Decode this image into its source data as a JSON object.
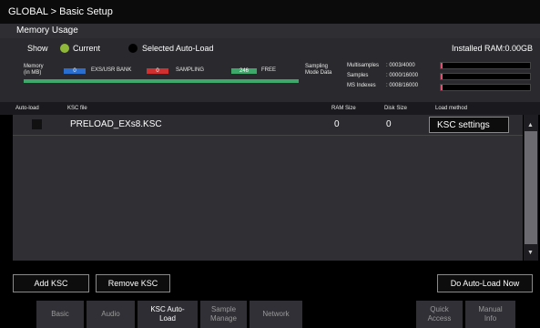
{
  "title": "GLOBAL > Basic Setup",
  "memory": {
    "header": "Memory Usage",
    "show_label": "Show",
    "current_label": "Current",
    "selected_label": "Selected Auto-Load",
    "installed_ram": "Installed RAM:0.00GB",
    "memory_label": "Memory (in MB)",
    "bars": [
      {
        "value": "0",
        "label": "EXS/USR BANK",
        "color": "#2a6fd0"
      },
      {
        "value": "0",
        "label": "SAMPLING",
        "color": "#d03030"
      },
      {
        "value": "246",
        "label": "FREE",
        "color": "#3ea86a"
      }
    ],
    "sampling_mode_label": "Sampling Mode Data",
    "stats": [
      {
        "label": "Multisamples",
        "value": ": 0003/4000"
      },
      {
        "label": "Samples",
        "value": ": 0000/16000"
      },
      {
        "label": "MS Indexes",
        "value": ": 0008/16000"
      }
    ]
  },
  "table": {
    "columns": [
      "Auto-load",
      "KSC file",
      "RAM Size",
      "Disk Size",
      "Load method"
    ],
    "rows": [
      {
        "file": "PRELOAD_EXs8.KSC",
        "ram": "0",
        "disk": "0",
        "method": "KSC settings"
      }
    ]
  },
  "buttons": {
    "add": "Add KSC",
    "remove": "Remove KSC",
    "auto_load": "Do Auto-Load Now"
  },
  "tabs": [
    {
      "label": "Basic"
    },
    {
      "label": "Audio"
    },
    {
      "label": "KSC Auto-Load",
      "active": true
    },
    {
      "label": "Sample Manage"
    },
    {
      "label": "Network"
    },
    {
      "label": "Quick Access"
    },
    {
      "label": "Manual Info"
    }
  ],
  "colors": {
    "accent_green": "#8fb83a",
    "bar_green": "#3ea86a",
    "ram_meter": "#e05070"
  }
}
